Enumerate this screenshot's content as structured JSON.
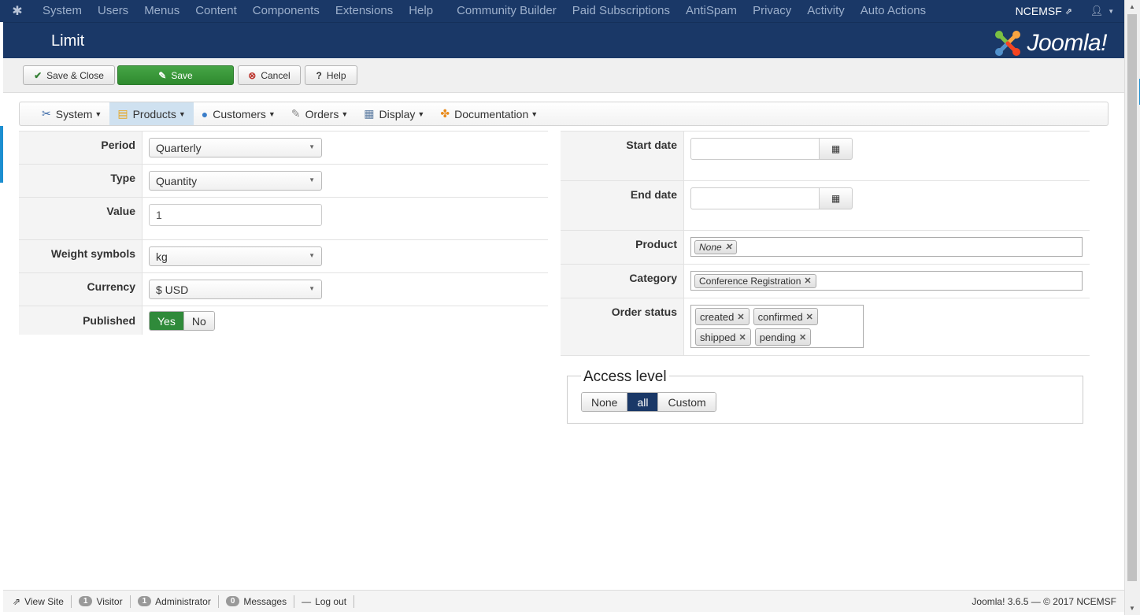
{
  "topbar": {
    "menu": [
      "System",
      "Users",
      "Menus",
      "Content",
      "Components",
      "Extensions",
      "Help",
      "Community Builder",
      "Paid Subscriptions",
      "AntiSpam",
      "Privacy",
      "Activity",
      "Auto Actions"
    ],
    "site_name": "NCEMSF"
  },
  "header": {
    "title": "Limit",
    "brand": "Joomla!"
  },
  "toolbar": {
    "save_close": "Save & Close",
    "save": "Save",
    "cancel": "Cancel",
    "help": "Help"
  },
  "submenu": [
    "System",
    "Products",
    "Customers",
    "Orders",
    "Display",
    "Documentation"
  ],
  "form_left": {
    "period": {
      "label": "Period",
      "value": "Quarterly"
    },
    "type": {
      "label": "Type",
      "value": "Quantity"
    },
    "value": {
      "label": "Value",
      "value": "1"
    },
    "weight": {
      "label": "Weight symbols",
      "value": "kg"
    },
    "currency": {
      "label": "Currency",
      "value": "$ USD"
    },
    "published": {
      "label": "Published",
      "yes": "Yes",
      "no": "No"
    }
  },
  "form_right": {
    "start_date": {
      "label": "Start date"
    },
    "end_date": {
      "label": "End date"
    },
    "product": {
      "label": "Product",
      "tags": [
        "None"
      ]
    },
    "category": {
      "label": "Category",
      "tags": [
        "Conference Registration"
      ]
    },
    "order_status": {
      "label": "Order status",
      "tags": [
        "created",
        "confirmed",
        "shipped",
        "pending"
      ]
    }
  },
  "access": {
    "legend": "Access level",
    "options": [
      "None",
      "all",
      "Custom"
    ],
    "selected": "all"
  },
  "status": {
    "view_site": "View Site",
    "visitor_count": "1",
    "visitor": "Visitor",
    "admin_count": "1",
    "admin": "Administrator",
    "messages_count": "0",
    "messages": "Messages",
    "logout": "Log out",
    "version": "Joomla! 3.6.5  —  © 2017 NCEMSF"
  },
  "colors": {
    "navbar": "#1a3867",
    "save_green": "#3b9a3b",
    "published_yes": "#2f8a3a",
    "access_active": "#1a3867"
  }
}
